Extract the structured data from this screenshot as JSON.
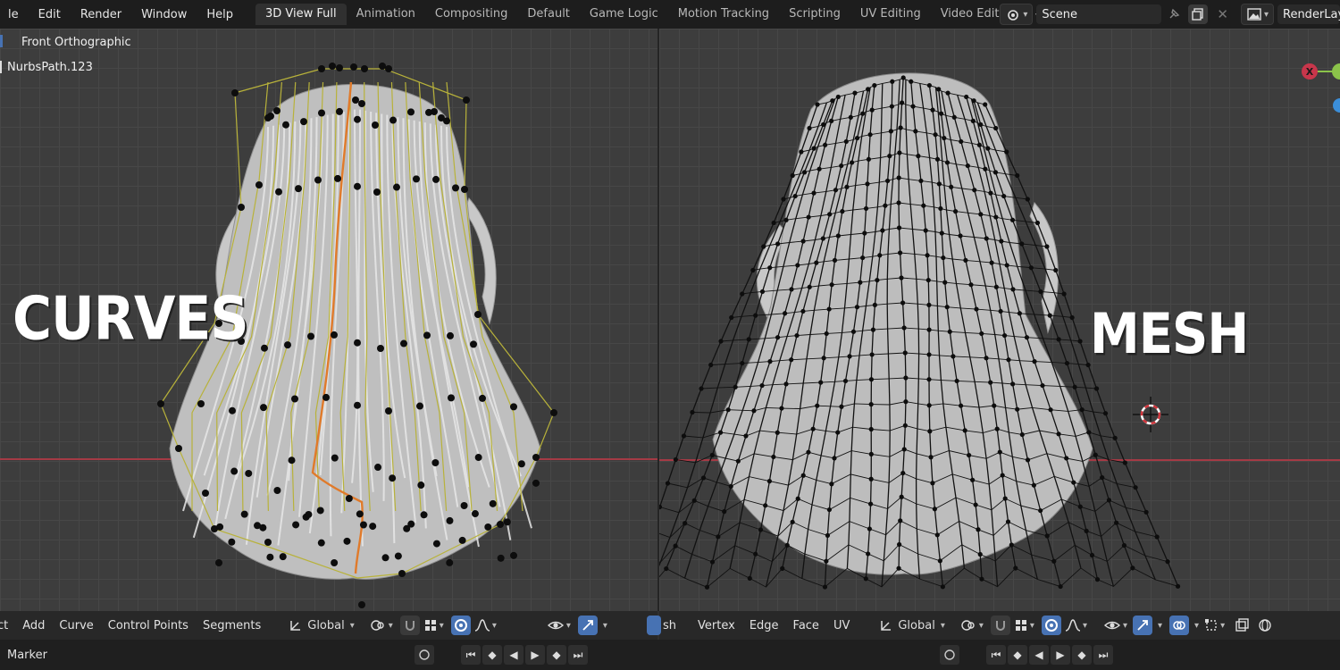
{
  "menu": [
    "le",
    "Edit",
    "Render",
    "Window",
    "Help"
  ],
  "workspace_tabs": [
    "3D View Full",
    "Animation",
    "Compositing",
    "Default",
    "Game Logic",
    "Motion Tracking",
    "Scripting",
    "UV Editing",
    "Video Editing"
  ],
  "active_tab": "3D View Full",
  "scene": {
    "label": "Scene",
    "render_layer": "RenderLaye"
  },
  "left_viewport": {
    "view_label": "Front Orthographic",
    "object_name": "NurbsPath.123",
    "overlay_text": "CURVES",
    "header": {
      "items": [
        "ct",
        "Add",
        "Curve",
        "Control Points",
        "Segments"
      ],
      "transform_orientation": "Global"
    }
  },
  "right_viewport": {
    "overlay_text": "MESH",
    "gizmo_x_label": "X",
    "header": {
      "items": [
        "sh",
        "Vertex",
        "Edge",
        "Face",
        "UV"
      ],
      "transform_orientation": "Global"
    }
  },
  "timeline": {
    "marker_label": "Marker"
  },
  "colors": {
    "accent_blue": "#4772b3",
    "curve_yellow": "#b8b23a",
    "active_orange": "#e07a2a",
    "x_axis_red": "#c8364b",
    "y_axis_green": "#8bc34a",
    "z_axis_blue": "#3b8ed9"
  }
}
